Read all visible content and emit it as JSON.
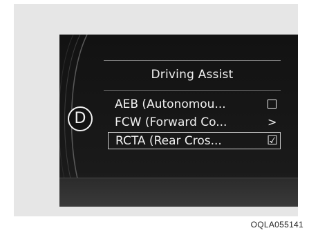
{
  "screen": {
    "gear": "D",
    "menu_title": "Driving Assist",
    "items": [
      {
        "label": "AEB (Autonomou...",
        "control": "checkbox",
        "checked": false,
        "selected": false
      },
      {
        "label": "FCW (Forward Co...",
        "control": "arrow",
        "icon": "chevron-right-icon",
        "symbol": ">",
        "selected": false
      },
      {
        "label": "RCTA (Rear Cros...",
        "control": "checkbox",
        "checked": true,
        "check_symbol": "☑",
        "selected": true
      }
    ]
  },
  "caption": "OQLA055141",
  "colors": {
    "screen_bg": "#121212",
    "text": "#f0f0f0",
    "frame_bg": "#e6e6e6"
  }
}
